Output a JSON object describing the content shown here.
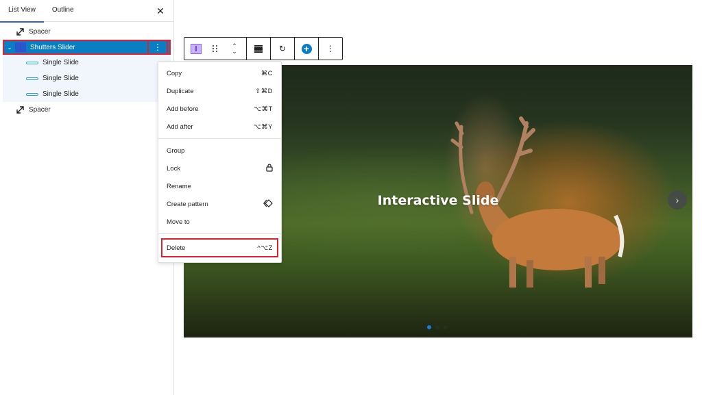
{
  "sidebar": {
    "tabs": [
      {
        "label": "List View",
        "active": true
      },
      {
        "label": "Outline",
        "active": false
      }
    ],
    "close_icon": "close-icon",
    "tree": [
      {
        "label": "Spacer",
        "icon": "resize-icon",
        "level": 0
      },
      {
        "label": "Shutters Slider",
        "icon": "slider-icon",
        "level": 0,
        "selected": true,
        "expanded": true
      },
      {
        "label": "Single Slide",
        "icon": "slide-icon",
        "level": 1
      },
      {
        "label": "Single Slide",
        "icon": "slide-icon",
        "level": 1
      },
      {
        "label": "Single Slide",
        "icon": "slide-icon",
        "level": 1
      },
      {
        "label": "Spacer",
        "icon": "resize-icon",
        "level": 0
      }
    ],
    "options_glyph": "⋮"
  },
  "toolbar": {
    "buttons": [
      {
        "name": "block-type",
        "icon": "slider-block-icon"
      },
      {
        "name": "drag",
        "icon": "drag-handle-icon"
      },
      {
        "name": "move-up",
        "glyph": "⌃"
      },
      {
        "name": "move-down",
        "glyph": "⌄"
      },
      {
        "name": "align",
        "icon": "align-icon"
      },
      {
        "name": "refresh",
        "glyph": "↻"
      },
      {
        "name": "add-slide",
        "glyph": "+"
      },
      {
        "name": "more-options",
        "glyph": "⋮"
      }
    ]
  },
  "menu": {
    "sections": [
      [
        {
          "label": "Copy",
          "shortcut": "⌘C"
        },
        {
          "label": "Duplicate",
          "shortcut": "⇧⌘D"
        },
        {
          "label": "Add before",
          "shortcut": "⌥⌘T"
        },
        {
          "label": "Add after",
          "shortcut": "⌥⌘Y"
        }
      ],
      [
        {
          "label": "Group",
          "shortcut": ""
        },
        {
          "label": "Lock",
          "icon": "lock-icon",
          "glyph": "🔒"
        },
        {
          "label": "Rename",
          "shortcut": ""
        },
        {
          "label": "Create pattern",
          "icon": "pattern-icon",
          "glyph": "◇"
        },
        {
          "label": "Move to",
          "shortcut": ""
        }
      ],
      [
        {
          "label": "Delete",
          "shortcut": "^⌥Z",
          "highlighted": true
        }
      ]
    ]
  },
  "slide": {
    "title": "Interactive Slide",
    "next_glyph": "›",
    "pagination": {
      "total": 3,
      "active": 1
    }
  },
  "colors": {
    "selected_row": "#0a7ec2",
    "highlight_border": "#e0202f",
    "active_dot": "#1f7ae0",
    "tab_underline": "#3858e9"
  }
}
